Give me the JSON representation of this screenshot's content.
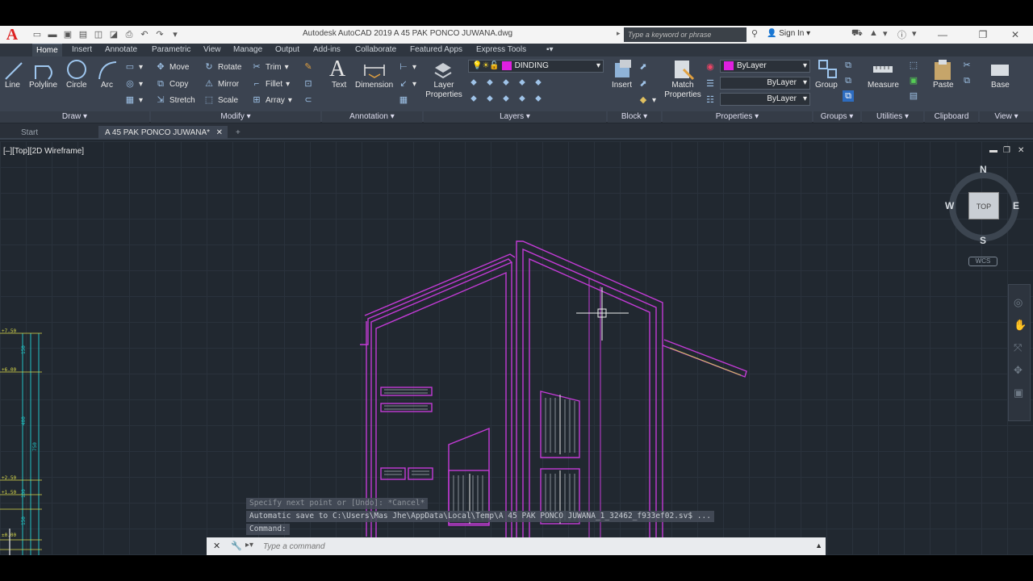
{
  "app": {
    "logo": "A",
    "title": "Autodesk AutoCAD 2019    A 45 PAK PONCO JUWANA.dwg",
    "search_placeholder": "Type a keyword or phrase",
    "sign_in": "Sign In"
  },
  "ribbon_tabs": [
    "Home",
    "Insert",
    "Annotate",
    "Parametric",
    "View",
    "Manage",
    "Output",
    "Add-ins",
    "Collaborate",
    "Featured Apps",
    "Express Tools"
  ],
  "draw": {
    "line": "Line",
    "polyline": "Polyline",
    "circle": "Circle",
    "arc": "Arc",
    "panel": "Draw"
  },
  "modify": {
    "move": "Move",
    "rotate": "Rotate",
    "trim": "Trim",
    "copy": "Copy",
    "mirror": "Mirror",
    "fillet": "Fillet",
    "stretch": "Stretch",
    "scale": "Scale",
    "array": "Array",
    "panel": "Modify"
  },
  "annotation": {
    "text": "Text",
    "dimension": "Dimension",
    "panel": "Annotation"
  },
  "layers": {
    "layer_properties": "Layer Properties",
    "current_layer": "DINDING",
    "panel": "Layers"
  },
  "block": {
    "insert": "Insert",
    "panel": "Block"
  },
  "properties": {
    "match": "Match Properties",
    "color": "ByLayer",
    "linetype": "ByLayer",
    "lineweight": "ByLayer",
    "panel": "Properties"
  },
  "groups": {
    "group": "Group",
    "panel": "Groups"
  },
  "utilities": {
    "measure": "Measure",
    "panel": "Utilities"
  },
  "clipboard": {
    "paste": "Paste",
    "panel": "Clipboard"
  },
  "view_panel": {
    "base": "Base",
    "panel": "View"
  },
  "doc_tabs": {
    "start": "Start",
    "active": "A 45 PAK PONCO JUWANA*"
  },
  "viewport": {
    "label": "[–][Top][2D Wireframe]",
    "compass": {
      "n": "N",
      "s": "S",
      "e": "E",
      "w": "W",
      "top": "TOP"
    },
    "wcs": "WCS"
  },
  "dimensions": {
    "levels": [
      "+7.50",
      "+6.00",
      "+2.50",
      "+1.50",
      "±0.00"
    ],
    "spans": [
      "150",
      "400",
      "750",
      "100",
      "150",
      "20"
    ]
  },
  "command": {
    "history_1": "Specify next point or [Undo]: *Cancel*",
    "history_2": "Automatic save to C:\\Users\\Mas Jhe\\AppData\\Local\\Temp\\A 45 PAK PONCO JUWANA_1_32462_f933ef02.sv$ ...",
    "history_3": "Command:",
    "placeholder": "Type a command"
  },
  "colors": {
    "magenta": "#c33bd6",
    "accent_blue": "#9ec6ee",
    "dim_cyan": "#22c1c3",
    "dim_yellow": "#d8d84a",
    "white": "#e6e6e6"
  }
}
